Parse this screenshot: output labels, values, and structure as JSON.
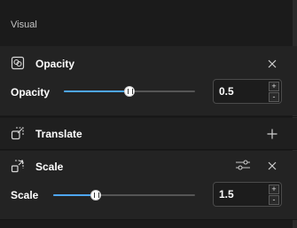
{
  "panel": {
    "section_title": "Visual",
    "items": {
      "opacity": {
        "title": "Opacity",
        "icon": "opacity-icon",
        "row_label": "Opacity",
        "value": "0.5",
        "slider_fraction": 0.5
      },
      "translate": {
        "title": "Translate",
        "icon": "translate-icon"
      },
      "scale": {
        "title": "Scale",
        "icon": "scale-icon",
        "row_label": "Scale",
        "value": "1.5",
        "slider_fraction": 0.3
      }
    },
    "spinner": {
      "up": "+",
      "down": "-"
    }
  },
  "colors": {
    "accent": "#4ea6f2",
    "background": "#1b1b1b",
    "group_background": "#232323"
  }
}
